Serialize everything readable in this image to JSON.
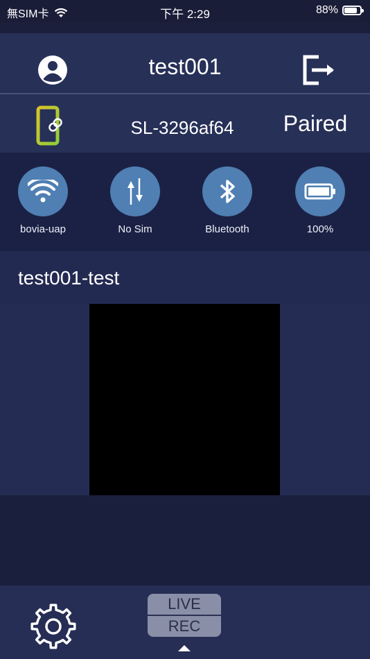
{
  "status_bar": {
    "carrier": "無SIM卡",
    "time": "下午 2:29",
    "battery_percent": "88%",
    "battery_level": 0.88
  },
  "header": {
    "title": "test001",
    "user_icon": "user-circle-icon",
    "logout_icon": "logout-icon"
  },
  "device": {
    "icon": "phone-link-icon",
    "name": "SL-3296af64",
    "status": "Paired"
  },
  "status_items": [
    {
      "icon": "wifi-icon",
      "label": "bovia-uap"
    },
    {
      "icon": "mobile-data-icon",
      "label": "No Sim"
    },
    {
      "icon": "bluetooth-icon",
      "label": "Bluetooth"
    },
    {
      "icon": "battery-icon",
      "label": "100%"
    }
  ],
  "camera": {
    "title": "test001-test"
  },
  "bottom_bar": {
    "settings_icon": "gear-icon",
    "mode_live": "LIVE",
    "mode_rec": "REC"
  },
  "colors": {
    "background": "#1b1f3b",
    "header": "#273057",
    "status_circle": "#4f7fb3",
    "mode_box": "#8a8fa8"
  }
}
